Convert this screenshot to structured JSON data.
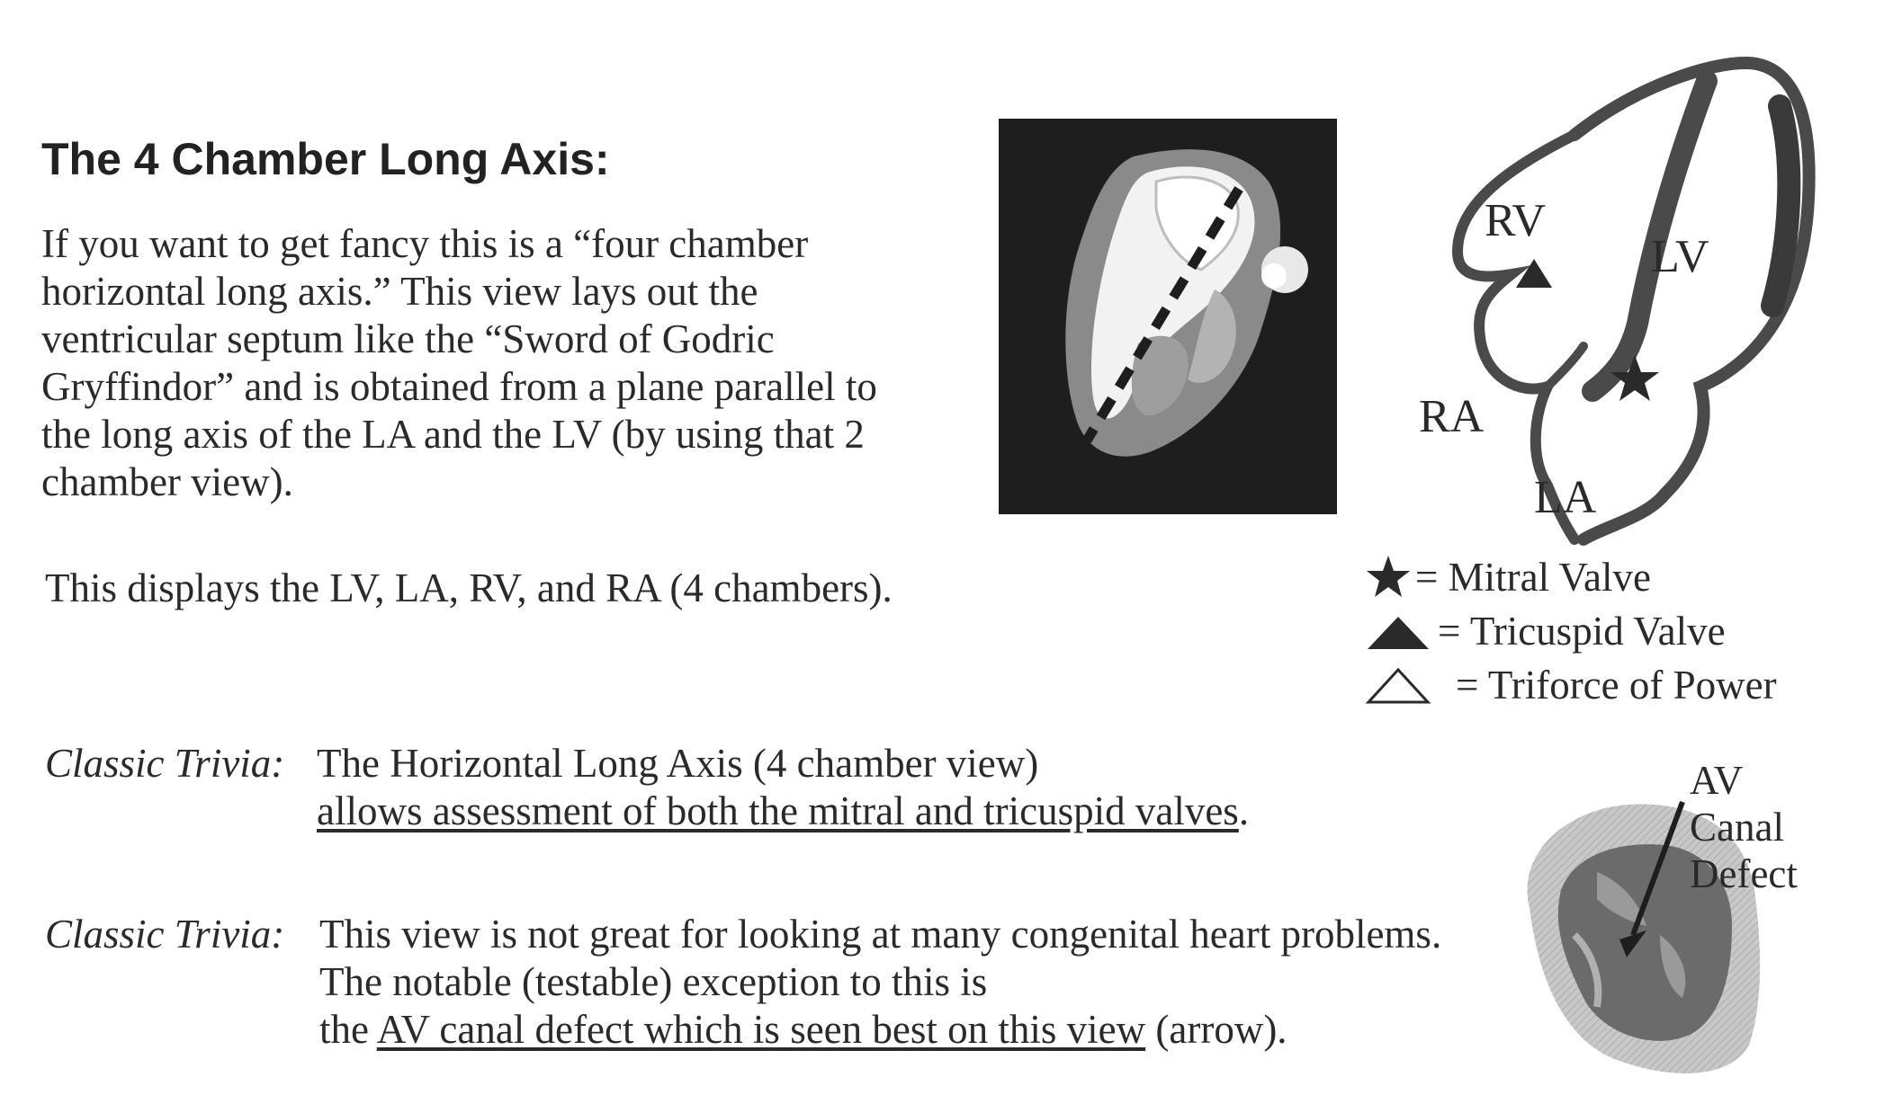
{
  "heading": "The 4 Chamber Long Axis:",
  "intro_lines": [
    "If you want to get fancy this is a “four chamber",
    "horizontal long axis.”  This view lays out the",
    "ventricular septum like the “Sword of Godric",
    "Gryffindor” and is obtained from a plane parallel to",
    "the long axis of the LA and the LV (by using that 2",
    "chamber view)."
  ],
  "displays": "This displays the LV, LA, RV, and RA (4 chambers).",
  "trivia1": {
    "label": "Classic Trivia:",
    "line1": "The Horizontal Long Axis (4 chamber view)",
    "line2_underlined": "allows assessment of both the mitral and tricuspid valves",
    "line2_after": "."
  },
  "trivia2": {
    "label": "Classic Trivia:",
    "line1": "This view is not great for looking at many congenital heart problems.",
    "line2": "The notable (testable) exception to this is",
    "line3_before": "the ",
    "line3_underlined": "AV canal defect which is seen best on this view",
    "line3_after": " (arrow)."
  },
  "diagram": {
    "rv": "RV",
    "lv": "LV",
    "ra": "RA",
    "la": "LA"
  },
  "legend": [
    {
      "symbol": "filled-star",
      "text": "= Mitral Valve"
    },
    {
      "symbol": "filled-triangle",
      "text": "= Tricuspid Valve"
    },
    {
      "symbol": "outline-triangle",
      "text": "= Triforce of Power"
    }
  ],
  "av_label": [
    "AV",
    "Canal",
    "Defect"
  ],
  "colors": {
    "text": "#2a2a2a",
    "dark_panel": "#1e1e1e",
    "heart_wall": "#4a4a4a"
  }
}
